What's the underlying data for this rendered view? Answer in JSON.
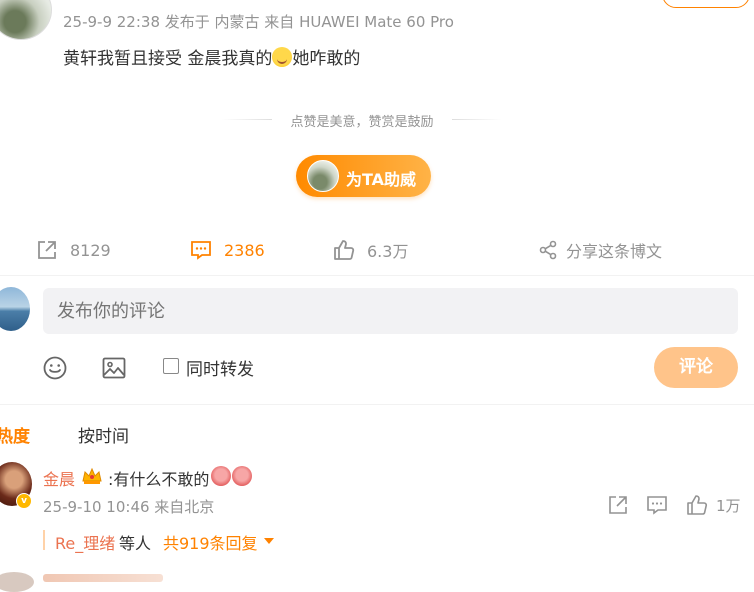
{
  "post": {
    "meta": "25-9-9 22:38 发布于 内蒙古 来自 HUAWEI Mate 60 Pro",
    "text_before": "黄轩我暂且接受 金晨我真的",
    "emoji_icon": "grin-emoji-icon",
    "text_after": "她咋敢的"
  },
  "reward": {
    "divider_text": "点赞是美意，赞赏是鼓励",
    "button_label": "为TA助威"
  },
  "actions": {
    "repost_count": "8129",
    "comment_count": "2386",
    "like_count": "6.3万",
    "share_label": "分享这条博文"
  },
  "composer": {
    "placeholder": "发布你的评论",
    "repost_label": "同时转发",
    "submit_label": "评论"
  },
  "sort": {
    "hot_label": "按热度",
    "hot_visible": "热度",
    "time_label": "按时间"
  },
  "comments": [
    {
      "author": "金晨",
      "text": ":有什么不敢的",
      "meta": "25-9-10 10:46 来自北京",
      "like_count": "1万",
      "verified_badge": "v",
      "reply_preview": {
        "user": "Re_理绪",
        "text": "等人",
        "more": "共919条回复"
      }
    }
  ],
  "colors": {
    "accent": "#ff8200",
    "username": "#eb7350",
    "muted": "#939393",
    "submit_disabled": "#ffc48a"
  }
}
